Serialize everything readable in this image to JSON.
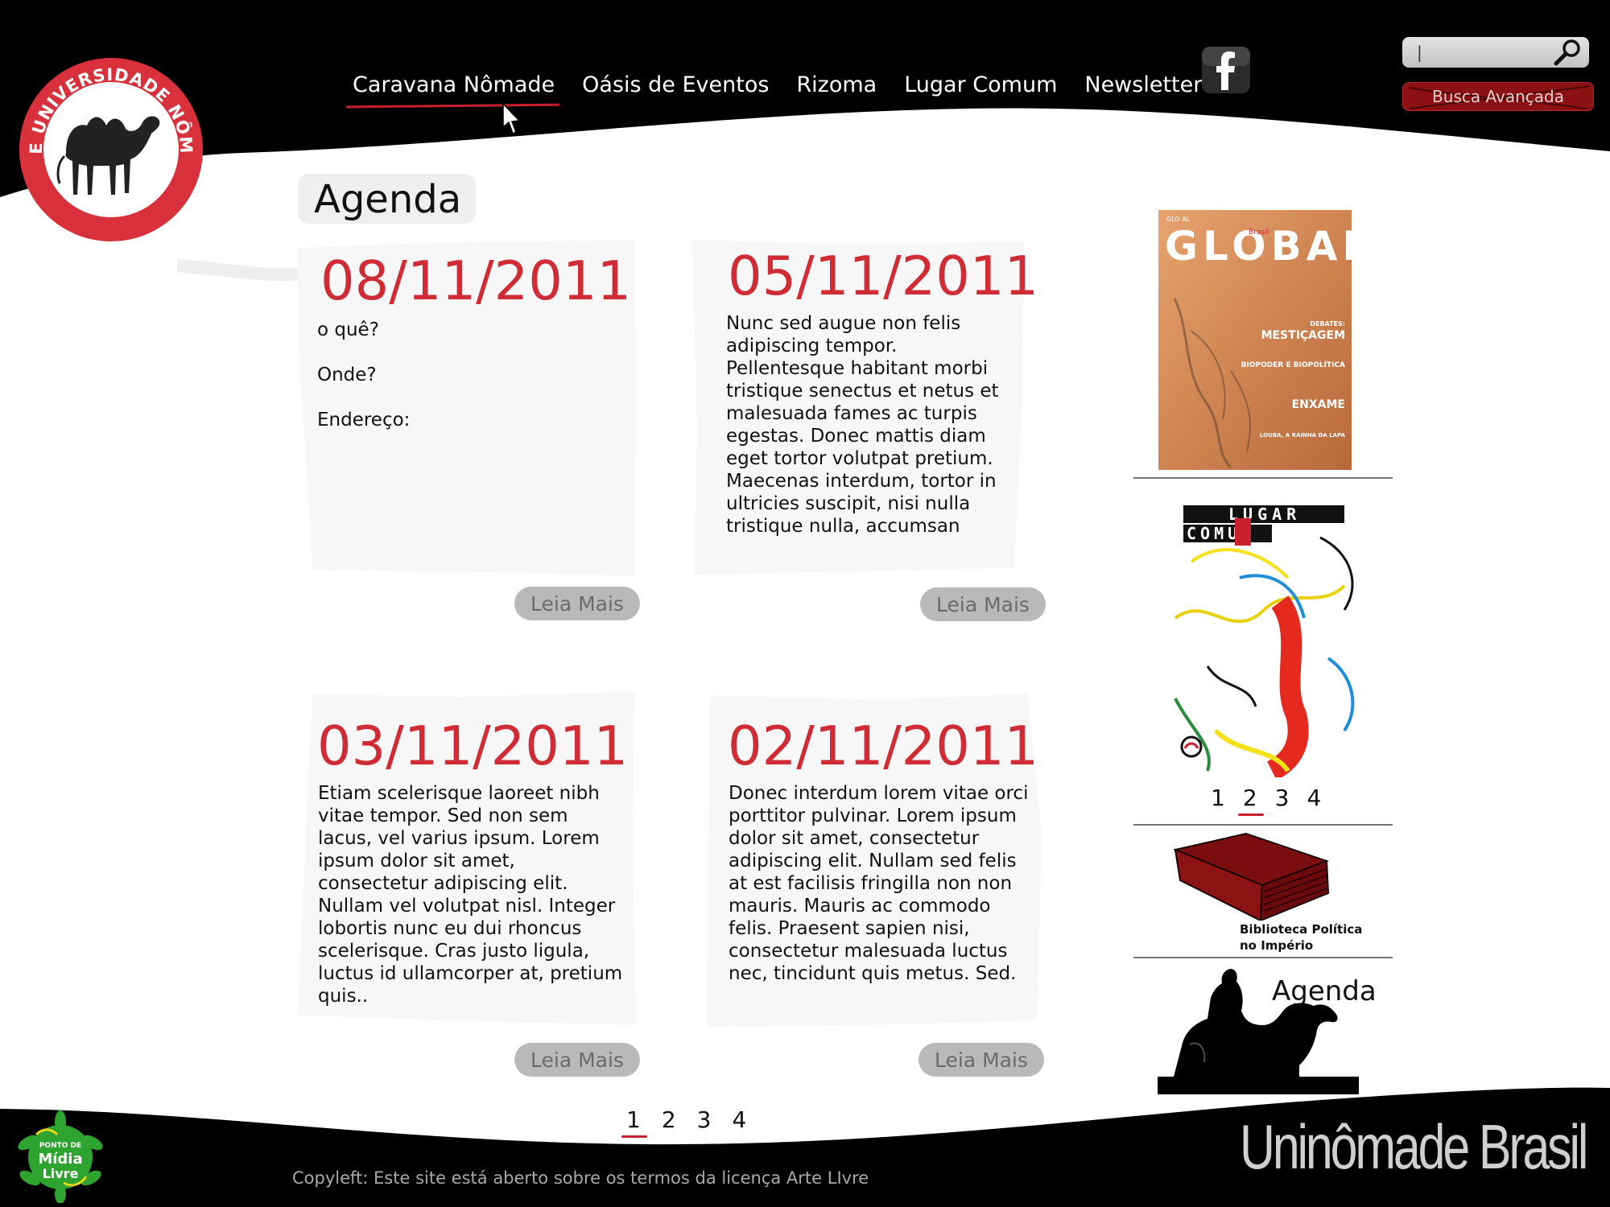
{
  "header": {
    "logo_text": "REDE UNIVERSIDADE NÔMADE",
    "nav": [
      {
        "label": "Caravana Nômade",
        "active": true
      },
      {
        "label": "Oásis de Eventos",
        "active": false
      },
      {
        "label": "Rizoma",
        "active": false
      },
      {
        "label": "Lugar Comum",
        "active": false
      },
      {
        "label": "Newsletter",
        "active": false
      }
    ],
    "search": {
      "value": "|",
      "icon": "magnifier-icon"
    },
    "advanced_search_label": "Busca Avançada",
    "social_icon": "facebook-icon"
  },
  "main": {
    "title": "Agenda",
    "events": [
      {
        "date": "08/11/2011",
        "fields": [
          "o quê?",
          "Onde?",
          "Endereço:"
        ],
        "button": "Leia Mais"
      },
      {
        "date": "05/11/2011",
        "body": "Nunc sed augue non felis adipiscing tempor. Pellentesque habitant morbi tristique senectus et netus et malesuada fames ac turpis egestas. Donec mattis diam eget tortor volutpat pretium. Maecenas interdum, tortor in ultricies suscipit, nisi nulla tristique nulla, accumsan",
        "button": "Leia Mais"
      },
      {
        "date": "03/11/2011",
        "body": "Etiam scelerisque laoreet nibh vitae tempor. Sed non sem lacus, vel varius ipsum. Lorem ipsum dolor sit amet, consectetur adipiscing elit. Nullam vel volutpat nisl. Integer lobortis nunc eu dui rhoncus scelerisque. Cras justo ligula, luctus id ullamcorper at, pretium quis..",
        "button": "Leia Mais"
      },
      {
        "date": "02/11/2011",
        "body": "Donec interdum lorem vitae orci porttitor pulvinar. Lorem ipsum dolor sit amet, consectetur adipiscing elit. Nullam sed felis at est facilisis fringilla non non mauris. Mauris ac commodo felis. Praesent sapien nisi, consectetur malesuada luctus nec, tincidunt quis metus. Sed.",
        "button": "Leia Mais"
      }
    ],
    "pagination": {
      "pages": [
        "1",
        "2",
        "3",
        "4"
      ],
      "active": "1"
    }
  },
  "sidebar": {
    "magazine_global": {
      "title": "GLOBAL",
      "small_text": [
        "GLO AL",
        "Brasil"
      ],
      "headlines": [
        "DEBATES:",
        "MESTIÇAGEM",
        "BIOPODER E BIOPOLÍTICA",
        "ENXAME",
        "LOUBA, A RAINHA DA LAPA"
      ]
    },
    "magazine_lugar_comum": {
      "title_line1": "LUGAR",
      "title_line2": "COMUM"
    },
    "pagination": {
      "pages": [
        "1",
        "2",
        "3",
        "4"
      ],
      "active": "2"
    },
    "book_label": [
      "Biblioteca Política",
      "no Império"
    ],
    "agenda_label": "Agenda"
  },
  "footer": {
    "copyleft": "Copyleft: Este site está aberto sobre os termos da licença Arte LIvre",
    "brand": "Uninômade Brasil",
    "punto_logo_text": [
      "PONTO DE",
      "Mídia",
      "Livre"
    ]
  },
  "colors": {
    "accent_red": "#cf2c36",
    "dark_red": "#8b1114",
    "black": "#000000",
    "card_bg": "#f7f7f7",
    "button_grey": "#b9b9b9"
  }
}
